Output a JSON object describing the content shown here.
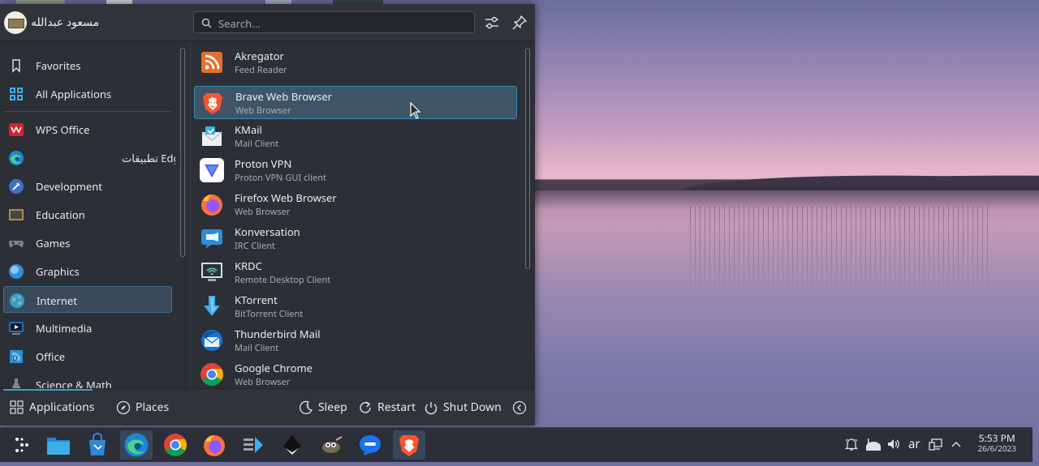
{
  "user": {
    "name": "مسعود عبدالله"
  },
  "search": {
    "placeholder": "Search..."
  },
  "categories": [
    {
      "label": "Favorites",
      "icon": "bookmark-icon"
    },
    {
      "label": "All Applications",
      "icon": "grid-icon"
    },
    {
      "label": "WPS Office",
      "icon": "wps-icon"
    },
    {
      "label": "تطبيقات Edge",
      "icon": "edge-icon"
    },
    {
      "label": "Development",
      "icon": "development-icon"
    },
    {
      "label": "Education",
      "icon": "education-icon"
    },
    {
      "label": "Games",
      "icon": "gamepad-icon"
    },
    {
      "label": "Graphics",
      "icon": "graphics-icon"
    },
    {
      "label": "Internet",
      "icon": "globe-icon"
    },
    {
      "label": "Multimedia",
      "icon": "multimedia-icon"
    },
    {
      "label": "Office",
      "icon": "office-icon"
    },
    {
      "label": "Science & Math",
      "icon": "flask-icon"
    }
  ],
  "apps": [
    {
      "name": "Akregator",
      "desc": "Feed Reader"
    },
    {
      "name": "Brave Web Browser",
      "desc": "Web Browser"
    },
    {
      "name": "KMail",
      "desc": "Mail Client"
    },
    {
      "name": "Proton VPN",
      "desc": "Proton VPN GUI client"
    },
    {
      "name": "Firefox Web Browser",
      "desc": "Web Browser"
    },
    {
      "name": "Konversation",
      "desc": "IRC Client"
    },
    {
      "name": "KRDC",
      "desc": "Remote Desktop Client"
    },
    {
      "name": "KTorrent",
      "desc": "BitTorrent Client"
    },
    {
      "name": "Thunderbird Mail",
      "desc": "Mail Client"
    },
    {
      "name": "Google Chrome",
      "desc": "Web Browser"
    }
  ],
  "footer": {
    "applications": "Applications",
    "places": "Places",
    "sleep": "Sleep",
    "restart": "Restart",
    "shutdown": "Shut Down"
  },
  "tray": {
    "language": "ar",
    "time": "5:53 PM",
    "date": "26/6/2023"
  },
  "colors": {
    "accent": "#3d9ee4",
    "panel": "#2c2f36",
    "taskbar": "#2c2e38"
  }
}
